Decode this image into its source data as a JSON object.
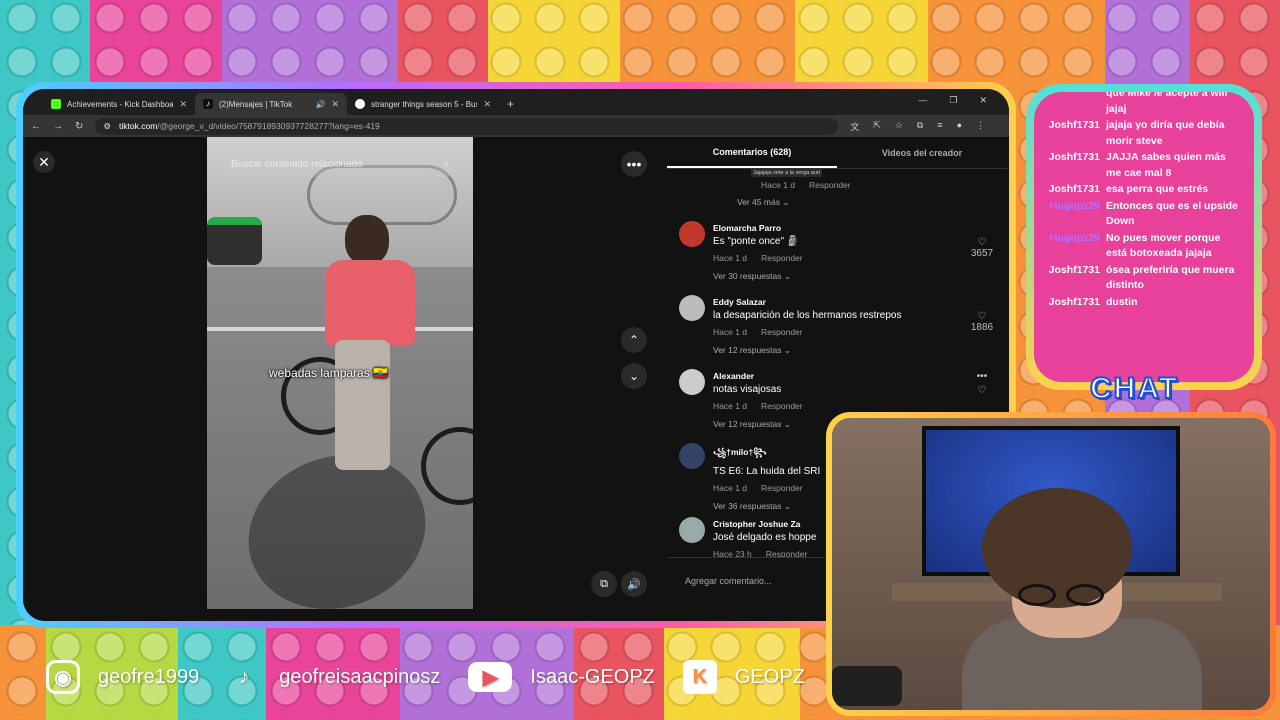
{
  "browser": {
    "tabs": [
      {
        "title": "Achievements - Kick Dashboard",
        "icon": "kick-icon",
        "color": "#53fc18"
      },
      {
        "title": "(2)Mensajes | TikTok",
        "icon": "tiktok-icon",
        "color": "#ffffff"
      },
      {
        "title": "stranger things season 5 - Busc",
        "icon": "google-icon",
        "color": "#ffffff"
      }
    ],
    "url_host": "tiktok.com",
    "url_path": "/@george_v_d/video/7587918930937728277?lang=es-419"
  },
  "tiktok": {
    "search_placeholder": "Buscar contenido relacionado",
    "caption": "webadas lamparas 🇪🇨",
    "tabs": {
      "comments": "Comentarios (628)",
      "creator": "Videos del creador"
    },
    "top_reply_text": "Jajajaja vete a la verga auri",
    "top_meta": {
      "time": "Hace 1 d",
      "reply": "Responder"
    },
    "top_more": "Ver 45 más",
    "comments": [
      {
        "name": "Elomarcha Parro",
        "text": "Es \"ponte once\" 🗿",
        "time": "Hace 1 d",
        "reply": "Responder",
        "likes": "3657",
        "more": "Ver 30 respuestas",
        "avatar_color": "#c0392b"
      },
      {
        "name": "Eddy Salazar",
        "text": "la desaparición de los hermanos restrepos",
        "time": "Hace 1 d",
        "reply": "Responder",
        "likes": "1886",
        "more": "Ver 12 respuestas",
        "avatar_color": "#bbbbbb"
      },
      {
        "name": "Alexander",
        "text": "notas visajosas",
        "time": "Hace 1 d",
        "reply": "Responder",
        "likes": "",
        "more": "Ver 12 respuestas",
        "avatar_color": "#cccccc"
      },
      {
        "name": "꧁†milo†꧂",
        "text": "TS E6: La huida del SRI",
        "time": "Hace 1 d",
        "reply": "Responder",
        "likes": "",
        "more": "Ver 36 respuestas",
        "avatar_color": "#334466"
      },
      {
        "name": "Cristopher Joshue Za",
        "text": "José delgado es hoppe",
        "time": "Hace 23 h",
        "reply": "Responder",
        "likes": "",
        "more": "",
        "avatar_color": "#99aaaa"
      }
    ],
    "add_comment": "Agregar comentario..."
  },
  "chat": {
    "title": "CHAT",
    "messages": [
      {
        "user": "",
        "text": "que Mike le acepte a will jajaj",
        "color": "#ffffff"
      },
      {
        "user": "Joshf1731",
        "text": "jajaja yo diría que debía morir steve",
        "color": "#ffffff"
      },
      {
        "user": "Joshf1731",
        "text": "JAJJA sabes quien más me cae mal 8",
        "color": "#ffffff"
      },
      {
        "user": "Joshf1731",
        "text": "esa perra que estrés",
        "color": "#ffffff"
      },
      {
        "user": "Hugopz29",
        "text": "Entonces que es el upside Down",
        "color": "#b46dff"
      },
      {
        "user": "Hugopz29",
        "text": "No pues mover porque está botoxeada jajaja",
        "color": "#b46dff"
      },
      {
        "user": "Joshf1731",
        "text": "ósea preferiría que muera distinto",
        "color": "#ffffff"
      },
      {
        "user": "Joshf1731",
        "text": "dustin",
        "color": "#ffffff"
      }
    ]
  },
  "socials": [
    {
      "icon": "instagram-icon",
      "handle": "geofre1999"
    },
    {
      "icon": "tiktok-icon",
      "handle": "geofreisaacpinosz"
    },
    {
      "icon": "youtube-icon",
      "handle": "Isaac-GEOPZ"
    },
    {
      "icon": "kick-icon",
      "handle": "GEOPZ"
    }
  ]
}
